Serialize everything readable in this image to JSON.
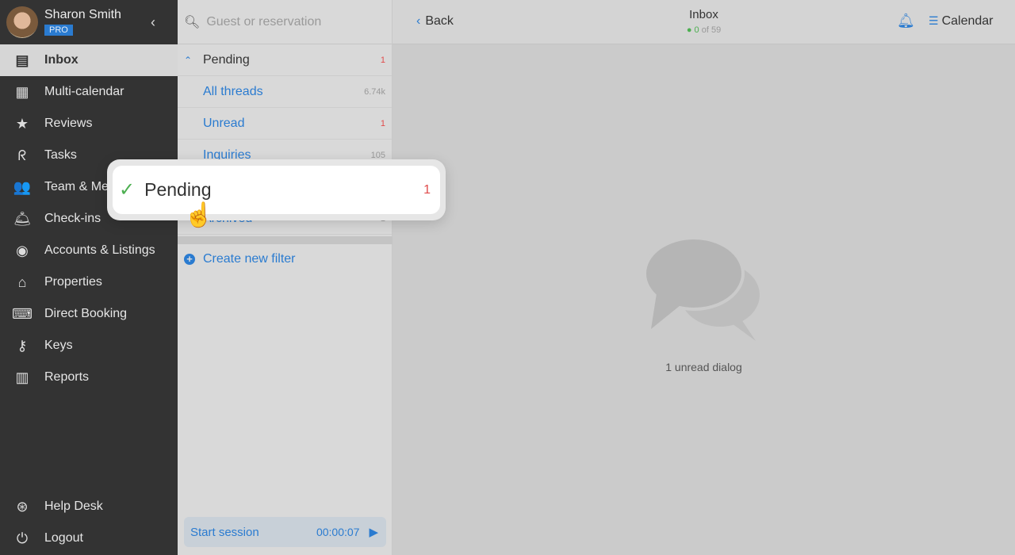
{
  "user": {
    "name": "Sharon Smith",
    "badge": "PRO"
  },
  "sidebar": {
    "items": [
      {
        "label": "Inbox",
        "icon": "inbox-icon",
        "glyph": "▤",
        "active": true
      },
      {
        "label": "Multi-calendar",
        "icon": "calendar-icon",
        "glyph": "▦"
      },
      {
        "label": "Reviews",
        "icon": "star-icon",
        "glyph": "★"
      },
      {
        "label": "Tasks",
        "icon": "vacuum-icon",
        "glyph": "ᖇ"
      },
      {
        "label": "Team & Members",
        "icon": "team-icon",
        "glyph": "👥"
      },
      {
        "label": "Check-ins",
        "icon": "bell-desk-icon",
        "glyph": "🛎"
      },
      {
        "label": "Accounts & Listings",
        "icon": "account-icon",
        "glyph": "◉"
      },
      {
        "label": "Properties",
        "icon": "home-icon",
        "glyph": "⌂"
      },
      {
        "label": "Direct Booking",
        "icon": "code-window-icon",
        "glyph": "⌨"
      },
      {
        "label": "Keys",
        "icon": "key-icon",
        "glyph": "⚷"
      },
      {
        "label": "Reports",
        "icon": "chart-icon",
        "glyph": "▥"
      }
    ],
    "bottom": [
      {
        "label": "Help Desk",
        "icon": "lifebuoy-icon",
        "glyph": "⊛"
      },
      {
        "label": "Logout",
        "icon": "power-icon",
        "glyph": "⏻"
      }
    ]
  },
  "search": {
    "placeholder": "Guest or reservation"
  },
  "filters": {
    "group": "Pending",
    "group_count": "1",
    "items": [
      {
        "label": "All threads",
        "count": "6.74k"
      },
      {
        "label": "Unread",
        "count": "1",
        "red": true
      },
      {
        "label": "Inquiries",
        "count": "105"
      },
      {
        "label": "Pending",
        "count": "1"
      },
      {
        "label": "Archived",
        "count": "1"
      }
    ],
    "create": "Create new filter"
  },
  "session": {
    "label": "Start session",
    "time": "00:00:07"
  },
  "header": {
    "back": "Back",
    "title": "Inbox",
    "online": "0",
    "total": "of 59",
    "calendar": "Calendar"
  },
  "empty": {
    "message": "1 unread dialog"
  },
  "popup": {
    "label": "Pending",
    "count": "1"
  }
}
